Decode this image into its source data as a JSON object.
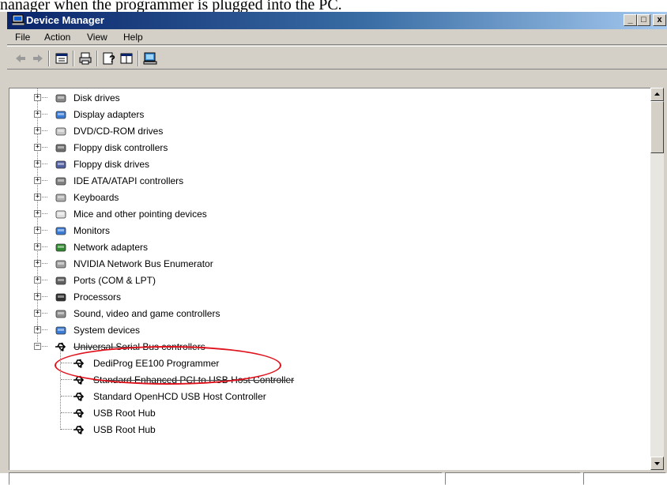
{
  "caption": "nanager when the programmer is plugged into the PC.",
  "window": {
    "title": "Device Manager",
    "controls": {
      "minimize": "_",
      "maximize": "□",
      "close": "x"
    }
  },
  "menubar": {
    "items": [
      {
        "label": "File"
      },
      {
        "label": "Action"
      },
      {
        "label": "View"
      },
      {
        "label": "Help"
      }
    ]
  },
  "toolbar": {
    "icons": [
      "back-icon",
      "forward-icon",
      "properties-icon",
      "print-icon",
      "help-icon",
      "show-hide-console-tree-icon",
      "scan-hardware-icon"
    ]
  },
  "tree": {
    "categories": [
      {
        "label": "Disk drives",
        "icon": "disk-drive-icon",
        "expanded": false
      },
      {
        "label": "Display adapters",
        "icon": "display-adapter-icon",
        "expanded": false
      },
      {
        "label": "DVD/CD-ROM drives",
        "icon": "cdrom-icon",
        "expanded": false
      },
      {
        "label": "Floppy disk controllers",
        "icon": "floppy-controller-icon",
        "expanded": false
      },
      {
        "label": "Floppy disk drives",
        "icon": "floppy-drive-icon",
        "expanded": false
      },
      {
        "label": "IDE ATA/ATAPI controllers",
        "icon": "ide-controller-icon",
        "expanded": false
      },
      {
        "label": "Keyboards",
        "icon": "keyboard-icon",
        "expanded": false
      },
      {
        "label": "Mice and other pointing devices",
        "icon": "mouse-icon",
        "expanded": false
      },
      {
        "label": "Monitors",
        "icon": "monitor-icon",
        "expanded": false
      },
      {
        "label": "Network adapters",
        "icon": "network-adapter-icon",
        "expanded": false
      },
      {
        "label": "NVIDIA Network Bus Enumerator",
        "icon": "bus-enumerator-icon",
        "expanded": false
      },
      {
        "label": "Ports (COM & LPT)",
        "icon": "port-icon",
        "expanded": false
      },
      {
        "label": "Processors",
        "icon": "processor-icon",
        "expanded": false
      },
      {
        "label": "Sound, video and game controllers",
        "icon": "sound-icon",
        "expanded": false
      },
      {
        "label": "System devices",
        "icon": "system-device-icon",
        "expanded": false
      },
      {
        "label": "Universal Serial Bus controllers",
        "icon": "usb-icon",
        "expanded": true
      }
    ],
    "usb_children": [
      {
        "label": "DediProg EE100 Programmer",
        "icon": "usb-device-icon",
        "highlighted": true
      },
      {
        "label": "Standard Enhanced PCI to USB Host Controller",
        "icon": "usb-device-icon"
      },
      {
        "label": "Standard OpenHCD USB Host Controller",
        "icon": "usb-device-icon"
      },
      {
        "label": "USB Root Hub",
        "icon": "usb-device-icon"
      },
      {
        "label": "USB Root Hub",
        "icon": "usb-device-icon"
      }
    ]
  },
  "annotation": {
    "color": "#e0141e",
    "shape": "ellipse",
    "target": "DediProg EE100 Programmer"
  },
  "colors": {
    "titlebar_start": "#0a246a",
    "titlebar_end": "#a6caf0",
    "chrome": "#d4d0c8"
  }
}
